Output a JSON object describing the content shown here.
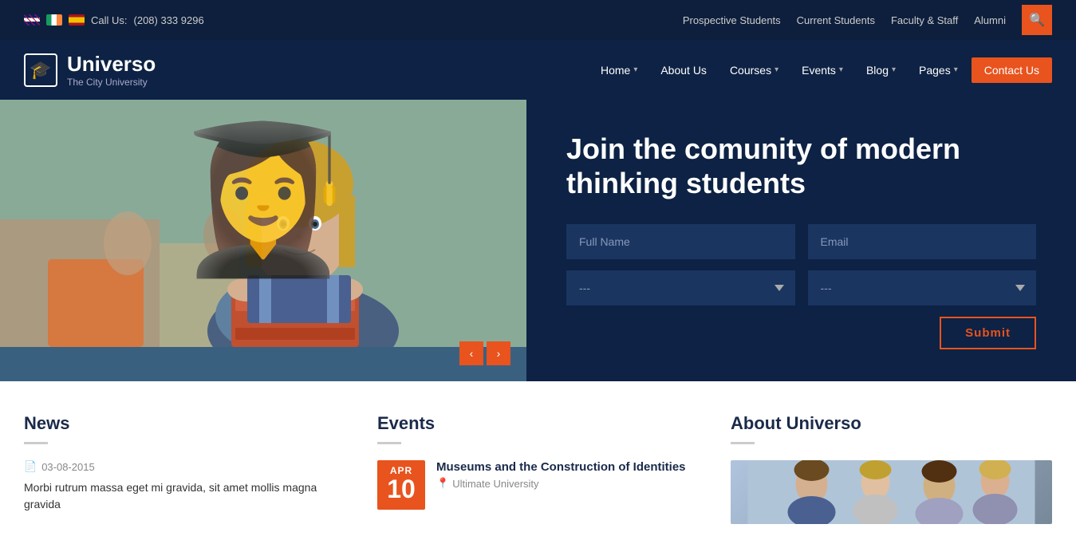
{
  "topbar": {
    "call_label": "Call Us:",
    "phone": "(208) 333 9296",
    "links": [
      "Prospective Students",
      "Current Students",
      "Faculty & Staff",
      "Alumni"
    ],
    "search_icon": "🔍"
  },
  "header": {
    "logo_name": "Universo",
    "logo_sub": "The City University",
    "logo_icon": "🎓",
    "nav_items": [
      {
        "label": "Home",
        "has_arrow": true
      },
      {
        "label": "About Us",
        "has_arrow": false
      },
      {
        "label": "Courses",
        "has_arrow": true
      },
      {
        "label": "Events",
        "has_arrow": true
      },
      {
        "label": "Blog",
        "has_arrow": true
      },
      {
        "label": "Pages",
        "has_arrow": true
      }
    ],
    "contact_label": "Contact Us"
  },
  "hero": {
    "title_line1": "Join the comunity of modern",
    "title_line2": "thinking students",
    "form": {
      "full_name_placeholder": "Full Name",
      "email_placeholder": "Email",
      "select1_placeholder": "---",
      "select2_placeholder": "---",
      "submit_label": "Submit"
    },
    "prev_icon": "‹",
    "next_icon": "›"
  },
  "news": {
    "section_title": "News",
    "date": "03-08-2015",
    "text": "Morbi rutrum massa eget mi gravida, sit amet mollis magna gravida"
  },
  "events": {
    "section_title": "Events",
    "items": [
      {
        "month": "APR",
        "day": "10",
        "title": "Museums and the Construction of Identities",
        "location": "Ultimate University"
      }
    ]
  },
  "about": {
    "section_title": "About Universo"
  }
}
